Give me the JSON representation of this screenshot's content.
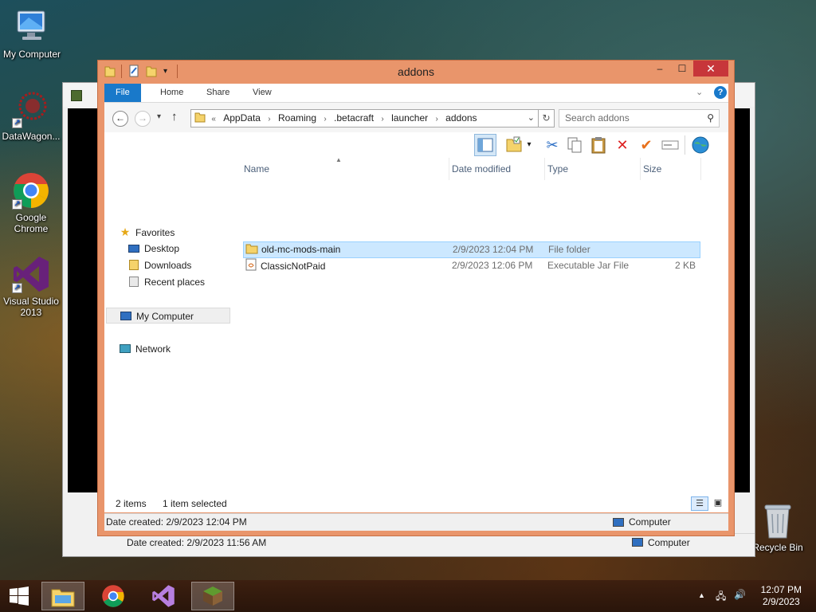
{
  "desktop": {
    "icons": [
      {
        "label": "My Computer"
      },
      {
        "label": "DataWagon..."
      },
      {
        "label": "Google Chrome"
      },
      {
        "label": "Visual Studio 2013"
      },
      {
        "label": "Recycle Bin"
      }
    ]
  },
  "background_window": {
    "status_date": "Date created: 2/9/2023 11:56 AM",
    "status_location": "Computer"
  },
  "window": {
    "title": "addons",
    "controls": {
      "minimize": "–",
      "maximize": "☐",
      "close": "✕"
    }
  },
  "ribbon": {
    "tabs": [
      {
        "label": "File"
      },
      {
        "label": "Home"
      },
      {
        "label": "Share"
      },
      {
        "label": "View"
      }
    ]
  },
  "address": {
    "overflow": "«",
    "segments": [
      "AppData",
      "Roaming",
      ".betacraft",
      "launcher",
      "addons"
    ]
  },
  "search": {
    "placeholder": "Search addons"
  },
  "navigation": {
    "favorites": "Favorites",
    "favorite_items": [
      {
        "label": "Desktop"
      },
      {
        "label": "Downloads"
      },
      {
        "label": "Recent places"
      }
    ],
    "computer": "My Computer",
    "network": "Network"
  },
  "columns": {
    "name": "Name",
    "date": "Date modified",
    "type": "Type",
    "size": "Size"
  },
  "files": [
    {
      "name": "old-mc-mods-main",
      "date": "2/9/2023 12:04 PM",
      "type": "File folder",
      "size": "",
      "selected": true
    },
    {
      "name": "ClassicNotPaid",
      "date": "2/9/2023 12:06 PM",
      "type": "Executable Jar File",
      "size": "2 KB",
      "selected": false
    }
  ],
  "status": {
    "items": "2 items",
    "selected": "1 item selected"
  },
  "details": {
    "date_created": "Date created: 2/9/2023 12:04 PM",
    "location": "Computer"
  },
  "taskbar": {
    "time": "12:07 PM",
    "date": "2/9/2023"
  },
  "colors": {
    "accent": "#1979ca",
    "window_frame": "#e9956b",
    "selection": "#cce8ff",
    "close_button": "#c7363a"
  }
}
